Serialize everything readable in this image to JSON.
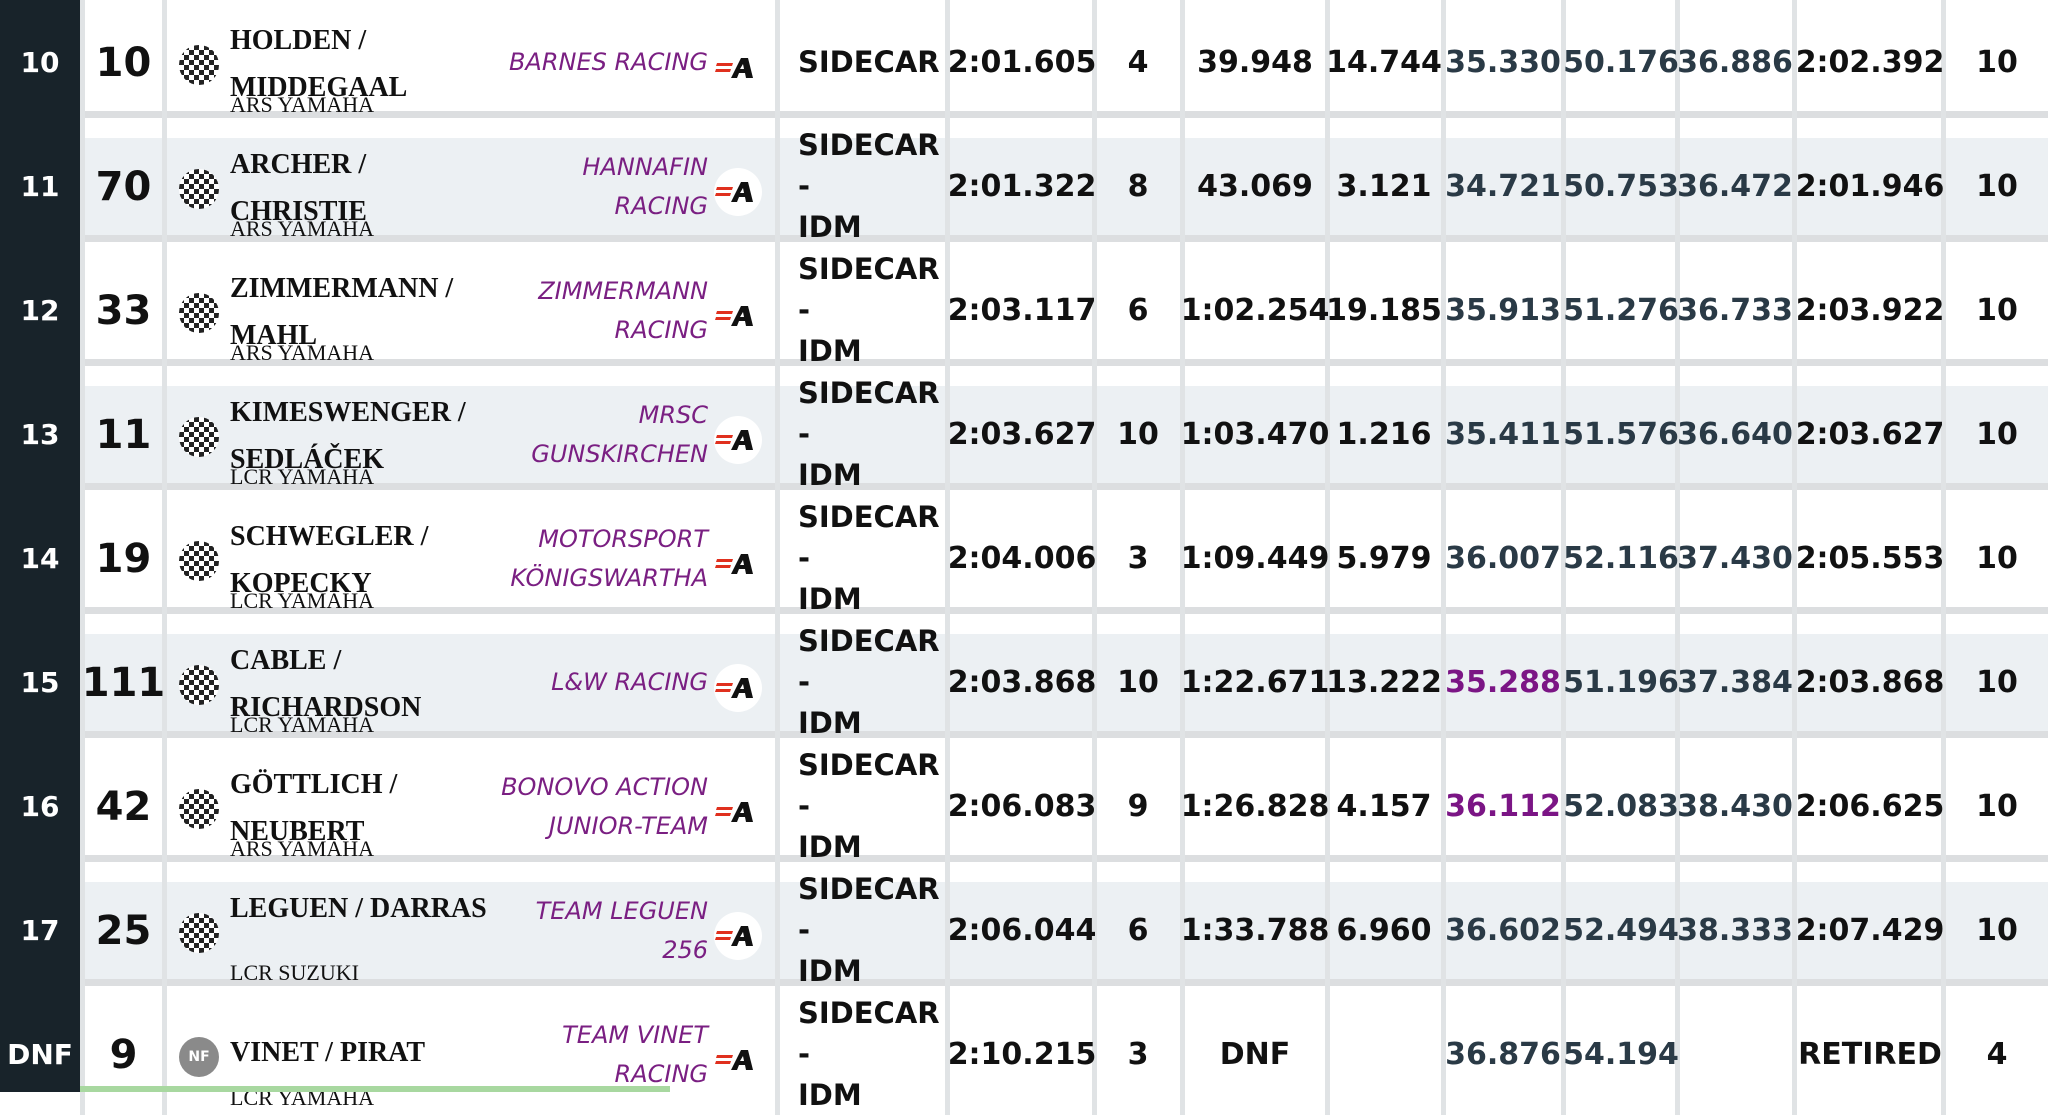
{
  "colors": {
    "rail": "#18232a",
    "purple_sector": "#7b1585",
    "team_text": "#7a1f82",
    "progress": "#a8d8a0"
  },
  "progress_fraction": 0.3,
  "results": [
    {
      "pos": "10",
      "num": "10",
      "flag": "checkered-flag-icon",
      "riders": "HOLDEN / MIDDEGAAL",
      "bike": "ARS YAMAHA",
      "team": "BARNES RACING",
      "class": "SIDECAR",
      "best": "2:01.605",
      "in_lap": "4",
      "gap": "39.948",
      "int": "14.744",
      "s1": "35.330",
      "s2": "50.176",
      "s3": "36.886",
      "last": "2:02.392",
      "laps": "10",
      "s1_purple": false
    },
    {
      "pos": "11",
      "num": "70",
      "flag": "checkered-flag-icon",
      "riders": "ARCHER / CHRISTIE",
      "bike": "ARS YAMAHA",
      "team": "HANNAFIN RACING",
      "class": "SIDECAR-IDM",
      "best": "2:01.322",
      "in_lap": "8",
      "gap": "43.069",
      "int": "3.121",
      "s1": "34.721",
      "s2": "50.753",
      "s3": "36.472",
      "last": "2:01.946",
      "laps": "10",
      "s1_purple": false
    },
    {
      "pos": "12",
      "num": "33",
      "flag": "checkered-flag-icon",
      "riders": "ZIMMERMANN / MAHL",
      "bike": "ARS YAMAHA",
      "team": "ZIMMERMANN RACING",
      "class": "SIDECAR-IDM",
      "best": "2:03.117",
      "in_lap": "6",
      "gap": "1:02.254",
      "int": "19.185",
      "s1": "35.913",
      "s2": "51.276",
      "s3": "36.733",
      "last": "2:03.922",
      "laps": "10",
      "s1_purple": false
    },
    {
      "pos": "13",
      "num": "11",
      "flag": "checkered-flag-icon",
      "riders": "KIMESWENGER / SEDLÁČEK",
      "bike": "LCR YAMAHA",
      "team": "MRSC GUNSKIRCHEN",
      "class": "SIDECAR-IDM",
      "best": "2:03.627",
      "in_lap": "10",
      "gap": "1:03.470",
      "int": "1.216",
      "s1": "35.411",
      "s2": "51.576",
      "s3": "36.640",
      "last": "2:03.627",
      "laps": "10",
      "s1_purple": false
    },
    {
      "pos": "14",
      "num": "19",
      "flag": "checkered-flag-icon",
      "riders": "SCHWEGLER / KOPECKY",
      "bike": "LCR YAMAHA",
      "team": "MOTORSPORT KÖNIGSWARTHA",
      "class": "SIDECAR-IDM",
      "best": "2:04.006",
      "in_lap": "3",
      "gap": "1:09.449",
      "int": "5.979",
      "s1": "36.007",
      "s2": "52.116",
      "s3": "37.430",
      "last": "2:05.553",
      "laps": "10",
      "s1_purple": false
    },
    {
      "pos": "15",
      "num": "111",
      "flag": "checkered-flag-icon",
      "riders": "CABLE / RICHARDSON",
      "bike": "LCR YAMAHA",
      "team": "L&W RACING",
      "class": "SIDECAR-IDM",
      "best": "2:03.868",
      "in_lap": "10",
      "gap": "1:22.671",
      "int": "13.222",
      "s1": "35.288",
      "s2": "51.196",
      "s3": "37.384",
      "last": "2:03.868",
      "laps": "10",
      "s1_purple": true
    },
    {
      "pos": "16",
      "num": "42",
      "flag": "checkered-flag-icon",
      "riders": "GÖTTLICH / NEUBERT",
      "bike": "ARS YAMAHA",
      "team": "BONOVO ACTION JUNIOR-TEAM",
      "class": "SIDECAR-IDM",
      "best": "2:06.083",
      "in_lap": "9",
      "gap": "1:26.828",
      "int": "4.157",
      "s1": "36.112",
      "s2": "52.083",
      "s3": "38.430",
      "last": "2:06.625",
      "laps": "10",
      "s1_purple": true
    },
    {
      "pos": "17",
      "num": "25",
      "flag": "checkered-flag-icon",
      "riders": "LEGUEN / DARRAS",
      "bike": "LCR SUZUKI",
      "team": "TEAM LEGUEN 256",
      "class": "SIDECAR-IDM",
      "best": "2:06.044",
      "in_lap": "6",
      "gap": "1:33.788",
      "int": "6.960",
      "s1": "36.602",
      "s2": "52.494",
      "s3": "38.333",
      "last": "2:07.429",
      "laps": "10",
      "s1_purple": false
    },
    {
      "pos": "DNF",
      "num": "9",
      "flag": "nf-icon",
      "flag_text": "NF",
      "riders": "VINET / PIRAT",
      "bike": "LCR YAMAHA",
      "team": "TEAM VINET RACING",
      "class": "SIDECAR-IDM",
      "best": "2:10.215",
      "in_lap": "3",
      "gap": "DNF",
      "int": "",
      "s1": "36.876",
      "s2": "54.194",
      "s3": "",
      "last": "RETIRED",
      "laps": "4",
      "s1_purple": false
    }
  ]
}
